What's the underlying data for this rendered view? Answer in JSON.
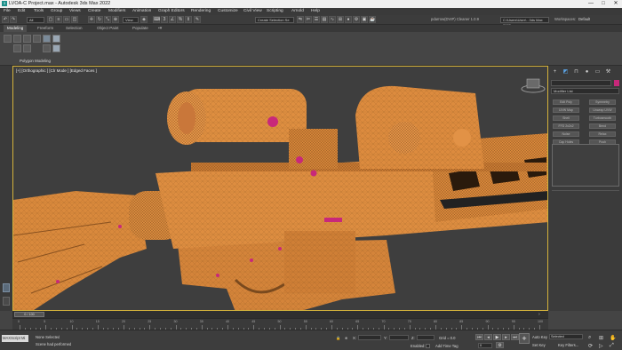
{
  "window": {
    "title": "LVOA-C Project.max - Autodesk 3ds Max 2022",
    "minimize": "—",
    "maximize": "□",
    "close": "✕"
  },
  "menu": [
    "File",
    "Edit",
    "Tools",
    "Group",
    "Views",
    "Create",
    "Modifiers",
    "Animation",
    "Graph Editors",
    "Rendering",
    "Customize",
    "Civil View",
    "Scripting",
    "Arnold",
    "Help"
  ],
  "menu_right": {
    "user_label": "pdarrow(DVIP) Cleaner 1.0.9",
    "workspaces_label": "Workspaces:",
    "workspace_value": "Default",
    "project_path": "C:\\Users\\User\\...3ds Max 2022"
  },
  "toolbar": {
    "filter_value": "All",
    "selection_set": "Create Selection Se",
    "view_value": "View"
  },
  "ribbon": {
    "tabs": [
      "Modeling",
      "Freeform",
      "Selection",
      "Object Paint",
      "Populate"
    ],
    "active_tab": "Modeling",
    "panel_label": "Polygon Modeling"
  },
  "viewport": {
    "label": "[+] [Orthographic ] [Clr Mode ] [Edged Faces ]"
  },
  "command_panel": {
    "modifier_list": "Modifier List",
    "buttons": [
      "Edit Poly",
      "Symmetry",
      "UVW Map",
      "Unwrap UVW",
      "Shell",
      "Turbosmooth",
      "FFD 2x2x2",
      "Bend",
      "Noise",
      "Relax",
      "Cap Holes",
      "Push",
      "Optimize",
      "ProOptimizer"
    ]
  },
  "timeline": {
    "frame_readout": "0 / 100",
    "ticks": [
      "0",
      "5",
      "10",
      "15",
      "20",
      "25",
      "30",
      "35",
      "40",
      "45",
      "50",
      "55",
      "60",
      "65",
      "70",
      "75",
      "80",
      "85",
      "90",
      "95",
      "100"
    ]
  },
  "status": {
    "maxscript_label": "MAXScript Mi",
    "selection": "None Selected",
    "prompt": "Scene had performed",
    "x_label": "X:",
    "x_value": "",
    "y_label": "Y:",
    "y_value": "",
    "z_label": "Z:",
    "z_value": "",
    "grid": "Grid = 0.0",
    "enabled_label": "Enabled:",
    "add_time_tag": "Add Time Tag",
    "auto_key": "Auto Key",
    "set_key": "Set Key",
    "key_mode": "Selected",
    "key_filters": "Key Filters...",
    "frame_value": "0"
  },
  "colors": {
    "model_orange": "#d9893c",
    "selection_border": "#d4b23b",
    "vertex_magenta": "#c8287a",
    "background": "#3e3e3e"
  }
}
